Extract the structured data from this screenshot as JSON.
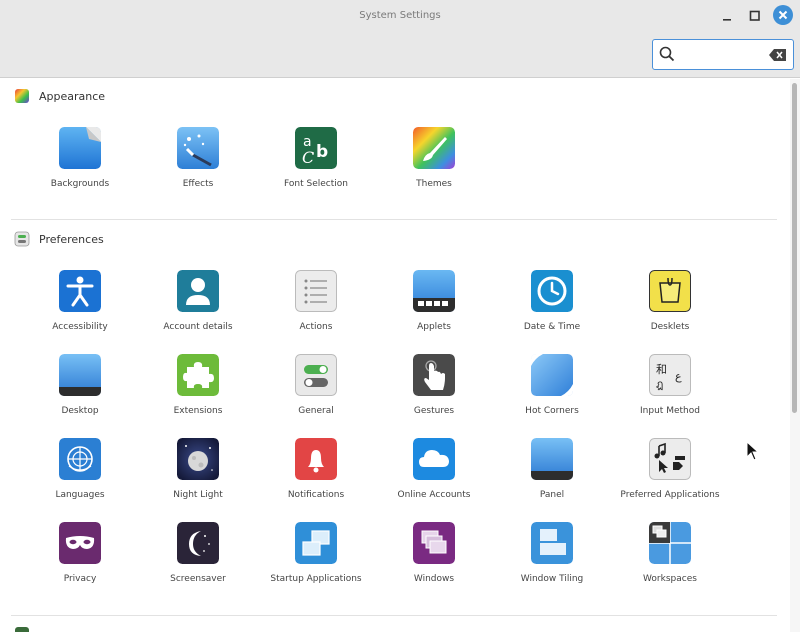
{
  "window": {
    "title": "System Settings",
    "search": {
      "value": "",
      "placeholder": ""
    }
  },
  "colors": {
    "accent": "#3d8fd6",
    "titlebar": "#e8e8e8"
  },
  "sections": [
    {
      "name": "Appearance",
      "icon": "appearance-icon",
      "items": [
        {
          "label": "Backgrounds",
          "icon": "backgrounds-icon"
        },
        {
          "label": "Effects",
          "icon": "effects-icon"
        },
        {
          "label": "Font Selection",
          "icon": "font-selection-icon"
        },
        {
          "label": "Themes",
          "icon": "themes-icon"
        }
      ]
    },
    {
      "name": "Preferences",
      "icon": "preferences-icon",
      "items": [
        {
          "label": "Accessibility",
          "icon": "accessibility-icon"
        },
        {
          "label": "Account details",
          "icon": "account-details-icon"
        },
        {
          "label": "Actions",
          "icon": "actions-icon"
        },
        {
          "label": "Applets",
          "icon": "applets-icon"
        },
        {
          "label": "Date & Time",
          "icon": "clock-icon"
        },
        {
          "label": "Desklets",
          "icon": "desklets-icon"
        },
        {
          "label": "Desktop",
          "icon": "desktop-icon"
        },
        {
          "label": "Extensions",
          "icon": "puzzle-icon"
        },
        {
          "label": "General",
          "icon": "toggle-icon"
        },
        {
          "label": "Gestures",
          "icon": "hand-icon"
        },
        {
          "label": "Hot Corners",
          "icon": "hot-corners-icon"
        },
        {
          "label": "Input Method",
          "icon": "input-method-icon"
        },
        {
          "label": "Languages",
          "icon": "globe-icon"
        },
        {
          "label": "Night Light",
          "icon": "moon-icon"
        },
        {
          "label": "Notifications",
          "icon": "bell-icon"
        },
        {
          "label": "Online Accounts",
          "icon": "cloud-icon"
        },
        {
          "label": "Panel",
          "icon": "panel-icon"
        },
        {
          "label": "Preferred Applications",
          "icon": "preferred-apps-icon"
        },
        {
          "label": "Privacy",
          "icon": "mask-icon"
        },
        {
          "label": "Screensaver",
          "icon": "screensaver-icon"
        },
        {
          "label": "Startup Applications",
          "icon": "startup-apps-icon"
        },
        {
          "label": "Windows",
          "icon": "windows-icon"
        },
        {
          "label": "Window Tiling",
          "icon": "window-tiling-icon"
        },
        {
          "label": "Workspaces",
          "icon": "workspaces-icon"
        }
      ]
    }
  ]
}
